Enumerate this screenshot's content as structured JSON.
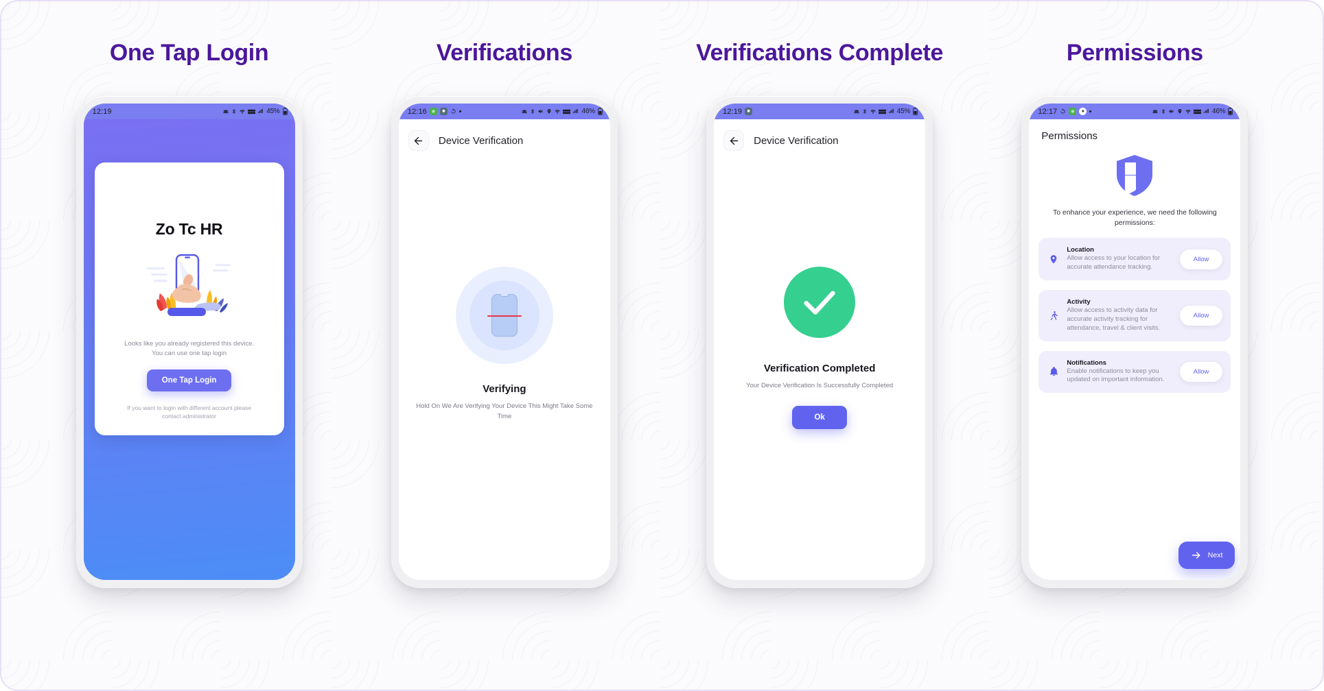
{
  "theme": {
    "title_color": "#4b179b",
    "accent_purple": "#6163ef",
    "accent_blue": "#4c8df6",
    "success_green": "#35cf8f",
    "card_lilac": "#f0eefc"
  },
  "columns": [
    {
      "title": "One Tap Login",
      "screen": "one-tap-login",
      "status": {
        "time": "12:19",
        "battery": "45%",
        "icons": [
          "alarm-icon",
          "bluetooth-icon",
          "wifi-icon",
          "lte-icon",
          "signal-icon"
        ]
      },
      "brand": "Zo Tc HR",
      "note": "Looks like you already registered this device.\nYou can use one tap login",
      "button": "One Tap Login",
      "footer": "If you want to login with different account please\ncontact administrator"
    },
    {
      "title": "Verifications",
      "screen": "device-verification",
      "status": {
        "time": "12:16",
        "battery": "46%",
        "icons": [
          "leaf-icon",
          "image-icon",
          "sync-icon",
          "dot-icon",
          "alarm-icon",
          "bluetooth-icon",
          "mute-icon",
          "location-icon",
          "wifi-icon",
          "lte-icon",
          "signal-icon"
        ]
      },
      "appbar_title": "Device Verification",
      "back_icon": "arrow-left-icon",
      "heading": "Verifying",
      "subtext": "Hold On We Are Verifying Your Device This Might Take Some Time"
    },
    {
      "title": "Verifications Complete",
      "screen": "verification-complete",
      "status": {
        "time": "12:19",
        "battery": "45%",
        "icons": [
          "image-icon",
          "alarm-icon",
          "bluetooth-icon",
          "wifi-icon",
          "lte-icon",
          "signal-icon"
        ]
      },
      "appbar_title": "Device Verification",
      "back_icon": "arrow-left-icon",
      "heading": "Verification Completed",
      "subtext": "Your Device Verification Is Successfully Completed",
      "button": "Ok"
    },
    {
      "title": "Permissions",
      "screen": "permissions",
      "status": {
        "time": "12:17",
        "battery": "46%",
        "icons": [
          "sync-icon",
          "leaf-icon",
          "compass-icon",
          "dot-icon",
          "alarm-icon",
          "bluetooth-icon",
          "mute-icon",
          "location-icon",
          "wifi-icon",
          "lte-icon",
          "signal-icon"
        ]
      },
      "page_title": "Permissions",
      "shield_icon": "shield-icon",
      "intro": "To enhance your experience, we need the following permissions:",
      "permissions": [
        {
          "icon": "location-pin-icon",
          "name": "Location",
          "desc": "Allow access to your location for accurate attendance tracking.",
          "action": "Allow"
        },
        {
          "icon": "activity-running-icon",
          "name": "Activity",
          "desc": "Allow access to activity data for accurate activity tracking for attendance, travel & client visits.",
          "action": "Allow"
        },
        {
          "icon": "notification-bell-icon",
          "name": "Notifications",
          "desc": "Enable notifications to keep you updated on important information.",
          "action": "Allow"
        }
      ],
      "next_button": "Next",
      "next_icon": "arrow-right-icon"
    }
  ]
}
